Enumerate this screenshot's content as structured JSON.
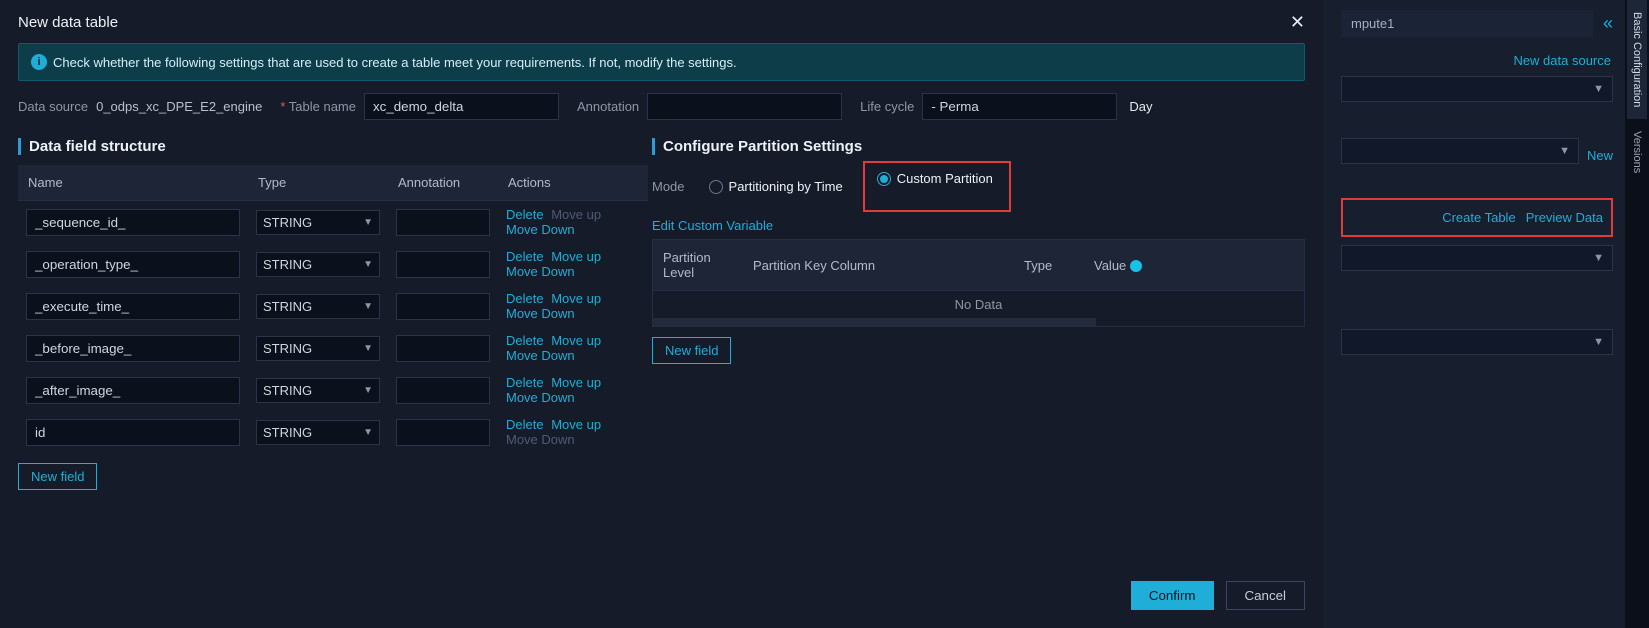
{
  "modal": {
    "title": "New data table",
    "close": "✕",
    "info": "Check whether the following settings that are used to create a table meet your requirements. If not, modify the settings.",
    "labels": {
      "datasource": "Data source",
      "tablename": "Table name",
      "annotation": "Annotation",
      "lifecycle": "Life cycle"
    },
    "values": {
      "datasource": "0_odps_xc_DPE_E2_engine",
      "tablename": "xc_demo_delta",
      "annotation": "",
      "lifecycle": "- Perma",
      "lifeunit": "Day"
    }
  },
  "left": {
    "section": "Data field structure",
    "headers": {
      "name": "Name",
      "type": "Type",
      "annotation": "Annotation",
      "actions": "Actions"
    },
    "type_option": "STRING",
    "actions": {
      "delete": "Delete",
      "moveup": "Move up",
      "movedown": "Move Down"
    },
    "rows": [
      {
        "name": "_sequence_id_",
        "first": true
      },
      {
        "name": "_operation_type_"
      },
      {
        "name": "_execute_time_"
      },
      {
        "name": "_before_image_"
      },
      {
        "name": "_after_image_"
      },
      {
        "name": "id",
        "last": true
      }
    ],
    "newfield": "New field"
  },
  "right": {
    "section": "Configure Partition Settings",
    "mode_label": "Mode",
    "mode_time": "Partitioning by Time",
    "mode_custom": "Custom Partition",
    "edit_custom": "Edit Custom Variable",
    "headers": {
      "level": "Partition Level",
      "keycol": "Partition Key Column",
      "type": "Type",
      "value": "Value"
    },
    "no_data": "No Data",
    "newfield": "New field"
  },
  "footer": {
    "confirm": "Confirm",
    "cancel": "Cancel"
  },
  "side": {
    "compute": "mpute1",
    "newds": "New data source",
    "new": "New",
    "create_table": "Create Table",
    "preview_data": "Preview Data"
  },
  "tabs": {
    "basic": "Basic Configuration",
    "versions": "Versions"
  }
}
